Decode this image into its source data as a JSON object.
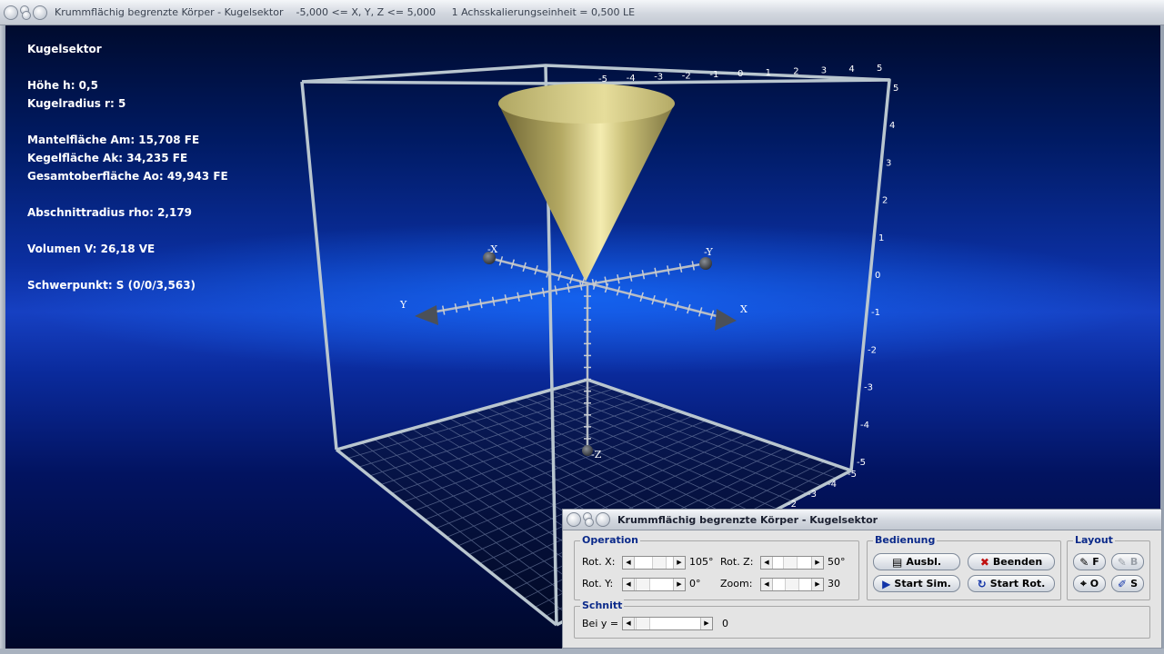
{
  "main_window": {
    "title": "Krummflächig begrenzte Körper - Kugelsektor",
    "range": "-5,000 <= X, Y, Z <= 5,000",
    "scale": "1 Achsskalierungseinheit = 0,500 LE"
  },
  "info": {
    "heading": "Kugelsektor",
    "hoehe": "Höhe h: 0,5",
    "radius": "Kugelradius r: 5",
    "mantel": "Mantelfläche Am: 15,708 FE",
    "kegel": "Kegelfläche Ak: 34,235 FE",
    "gesamt": "Gesamtoberfläche Ao: 49,943 FE",
    "rho": "Abschnittradius rho: 2,179",
    "volumen": "Volumen V: 26,18 VE",
    "schwerpunkt": "Schwerpunkt: S (0/0/3,563)"
  },
  "scene": {
    "axis_labels": {
      "x_pos": "X",
      "x_neg": "-X",
      "y_pos": "Y",
      "y_neg": "-Y",
      "z_neg": "-Z"
    },
    "top_ticks": [
      "-5",
      "-4",
      "-3",
      "-2",
      "-1",
      "0",
      "1",
      "2",
      "3",
      "4",
      "5"
    ],
    "right_ticks": [
      "5",
      "4",
      "3",
      "2",
      "1",
      "0",
      "-1",
      "-2",
      "-3",
      "-4",
      "-5"
    ],
    "bottom_ticks": [
      "-5",
      "-4",
      "-3",
      "-2"
    ],
    "colors": {
      "cone": "#c9bf77",
      "frame": "#b9c6cf",
      "background": "#0b2fa0"
    }
  },
  "panel": {
    "title": "Krummflächig begrenzte Körper - Kugelsektor",
    "operation": {
      "label": "Operation",
      "rot_x_label": "Rot. X:",
      "rot_x_value": "105°",
      "rot_y_label": "Rot. Y:",
      "rot_y_value": "0°",
      "rot_z_label": "Rot. Z:",
      "rot_z_value": "50°",
      "zoom_label": "Zoom:",
      "zoom_value": "30"
    },
    "bedienung": {
      "label": "Bedienung",
      "ausbl": "Ausbl.",
      "beenden": "Beenden",
      "start_sim": "Start Sim.",
      "start_rot": "Start Rot."
    },
    "layout": {
      "label": "Layout",
      "f": "F",
      "b": "B",
      "o": "O",
      "s": "S"
    },
    "schnitt": {
      "label": "Schnitt",
      "bei_y": "Bei y =",
      "value": "0"
    }
  }
}
